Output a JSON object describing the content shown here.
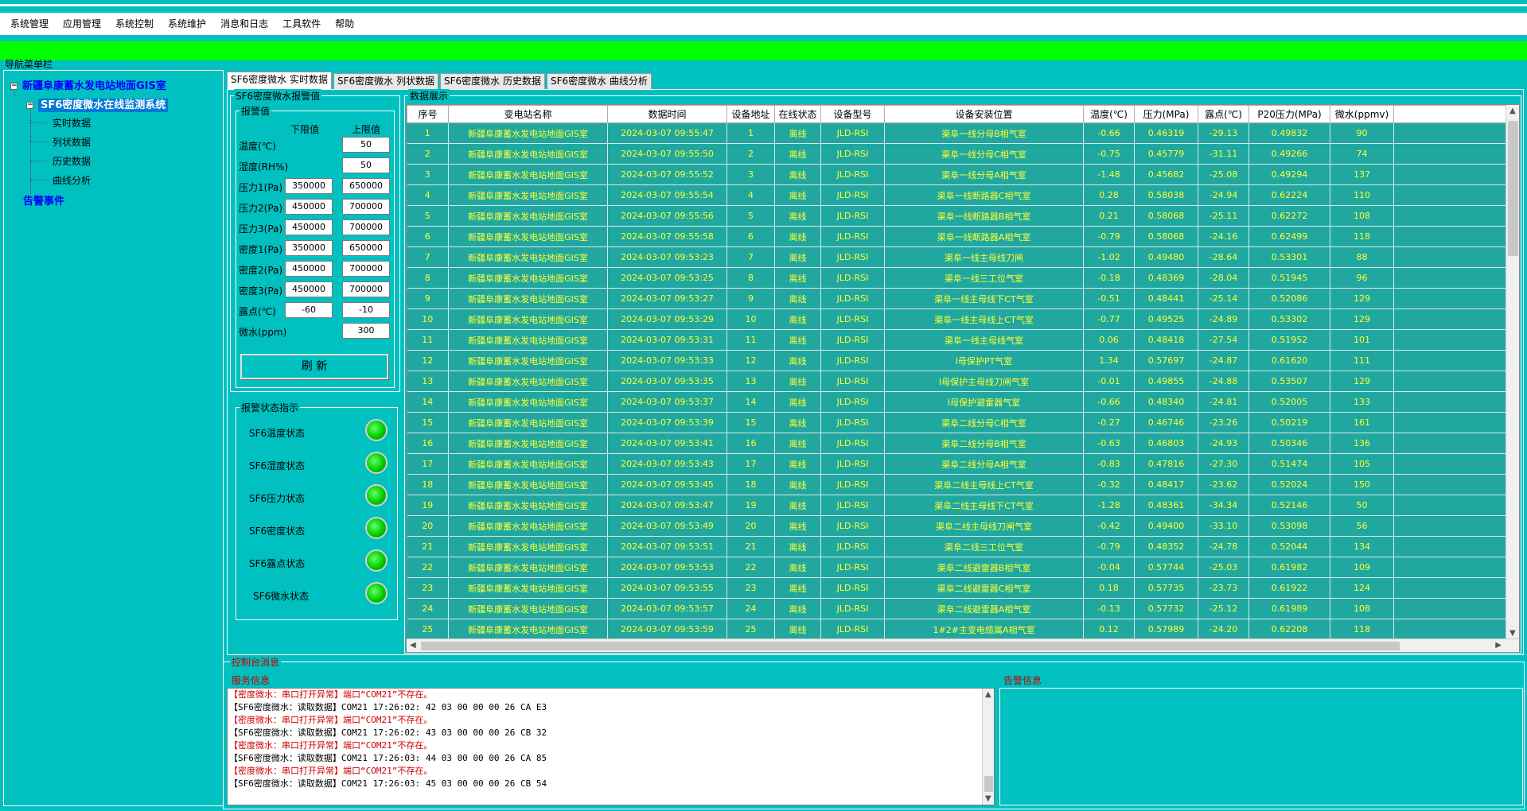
{
  "menu": [
    "系统管理",
    "应用管理",
    "系统控制",
    "系统维护",
    "消息和日志",
    "工具软件",
    "帮助"
  ],
  "nav": {
    "title": "导航菜单栏",
    "station": "新疆阜康蓄水发电站地面GIS室",
    "system": "SF6密度微水在线监测系统",
    "children": [
      "实时数据",
      "列状数据",
      "历史数据",
      "曲线分析"
    ],
    "alarm_events": "告警事件"
  },
  "tabs": [
    "SF6密度微水 实时数据",
    "SF6密度微水 列状数据",
    "SF6密度微水 历史数据",
    "SF6密度微水 曲线分析"
  ],
  "thresholds": {
    "group_title": "SF6密度微水报警值",
    "sub_title": "报警值",
    "lower_header": "下限值",
    "upper_header": "上限值",
    "rows": [
      {
        "label": "温度(℃)",
        "lower": "",
        "upper": "50"
      },
      {
        "label": "湿度(RH%)",
        "lower": "",
        "upper": "50"
      },
      {
        "label": "压力1(Pa)",
        "lower": "350000",
        "upper": "650000"
      },
      {
        "label": "压力2(Pa)",
        "lower": "450000",
        "upper": "700000"
      },
      {
        "label": "压力3(Pa)",
        "lower": "450000",
        "upper": "700000"
      },
      {
        "label": "密度1(Pa)",
        "lower": "350000",
        "upper": "650000"
      },
      {
        "label": "密度2(Pa)",
        "lower": "450000",
        "upper": "700000"
      },
      {
        "label": "密度3(Pa)",
        "lower": "450000",
        "upper": "700000"
      },
      {
        "label": "露点(℃)",
        "lower": "-60",
        "upper": "-10"
      },
      {
        "label": "微水(ppm)",
        "lower": "",
        "upper": "300"
      }
    ],
    "refresh_label": "刷 新"
  },
  "status": {
    "title": "报警状态指示",
    "items": [
      "SF6温度状态",
      "SF6湿度状态",
      "SF6压力状态",
      "SF6密度状态",
      "SF6露点状态",
      "SF6微水状态"
    ],
    "led_color": "#00cc00"
  },
  "grid": {
    "title": "数据展示",
    "columns": [
      "序号",
      "变电站名称",
      "数据时间",
      "设备地址",
      "在线状态",
      "设备型号",
      "设备安装位置",
      "温度(℃)",
      "压力(MPa)",
      "露点(℃)",
      "P20压力(MPa)",
      "微水(ppmv)",
      ""
    ],
    "rows": [
      [
        "1",
        "新疆阜康蓄水发电站地面GIS室",
        "2024-03-07 09:55:47",
        "1",
        "离线",
        "JLD-RSI",
        "渠阜一线分母B相气室",
        "-0.66",
        "0.46319",
        "-29.13",
        "0.49832",
        "90"
      ],
      [
        "2",
        "新疆阜康蓄水发电站地面GIS室",
        "2024-03-07 09:55:50",
        "2",
        "离线",
        "JLD-RSI",
        "渠阜一线分母C相气室",
        "-0.75",
        "0.45779",
        "-31.11",
        "0.49266",
        "74"
      ],
      [
        "3",
        "新疆阜康蓄水发电站地面GIS室",
        "2024-03-07 09:55:52",
        "3",
        "离线",
        "JLD-RSI",
        "渠阜一线分母A相气室",
        "-1.48",
        "0.45682",
        "-25.08",
        "0.49294",
        "137"
      ],
      [
        "4",
        "新疆阜康蓄水发电站地面GIS室",
        "2024-03-07 09:55:54",
        "4",
        "离线",
        "JLD-RSI",
        "渠阜一线断路器C相气室",
        "0.28",
        "0.58038",
        "-24.94",
        "0.62224",
        "110"
      ],
      [
        "5",
        "新疆阜康蓄水发电站地面GIS室",
        "2024-03-07 09:55:56",
        "5",
        "离线",
        "JLD-RSI",
        "渠阜一线断路器B相气室",
        "0.21",
        "0.58068",
        "-25.11",
        "0.62272",
        "108"
      ],
      [
        "6",
        "新疆阜康蓄水发电站地面GIS室",
        "2024-03-07 09:55:58",
        "6",
        "离线",
        "JLD-RSI",
        "渠阜一线断路器A相气室",
        "-0.79",
        "0.58068",
        "-24.16",
        "0.62499",
        "118"
      ],
      [
        "7",
        "新疆阜康蓄水发电站地面GIS室",
        "2024-03-07 09:53:23",
        "7",
        "离线",
        "JLD-RSI",
        "渠阜一线主母线刀闸",
        "-1.02",
        "0.49480",
        "-28.64",
        "0.53301",
        "88"
      ],
      [
        "8",
        "新疆阜康蓄水发电站地面GIS室",
        "2024-03-07 09:53:25",
        "8",
        "离线",
        "JLD-RSI",
        "渠阜一线三工位气室",
        "-0.18",
        "0.48369",
        "-28.04",
        "0.51945",
        "96"
      ],
      [
        "9",
        "新疆阜康蓄水发电站地面GIS室",
        "2024-03-07 09:53:27",
        "9",
        "离线",
        "JLD-RSI",
        "渠阜一线主母线下CT气室",
        "-0.51",
        "0.48441",
        "-25.14",
        "0.52086",
        "129"
      ],
      [
        "10",
        "新疆阜康蓄水发电站地面GIS室",
        "2024-03-07 09:53:29",
        "10",
        "离线",
        "JLD-RSI",
        "渠阜一线主母线上CT气室",
        "-0.77",
        "0.49525",
        "-24.89",
        "0.53302",
        "129"
      ],
      [
        "11",
        "新疆阜康蓄水发电站地面GIS室",
        "2024-03-07 09:53:31",
        "11",
        "离线",
        "JLD-RSI",
        "渠阜一线主母线气室",
        "0.06",
        "0.48418",
        "-27.54",
        "0.51952",
        "101"
      ],
      [
        "12",
        "新疆阜康蓄水发电站地面GIS室",
        "2024-03-07 09:53:33",
        "12",
        "离线",
        "JLD-RSI",
        "I母保护PT气室",
        "1.34",
        "0.57697",
        "-24.87",
        "0.61620",
        "111"
      ],
      [
        "13",
        "新疆阜康蓄水发电站地面GIS室",
        "2024-03-07 09:53:35",
        "13",
        "离线",
        "JLD-RSI",
        "I母保护主母线刀闸气室",
        "-0.01",
        "0.49855",
        "-24.88",
        "0.53507",
        "129"
      ],
      [
        "14",
        "新疆阜康蓄水发电站地面GIS室",
        "2024-03-07 09:53:37",
        "14",
        "离线",
        "JLD-RSI",
        "I母保护避雷器气室",
        "-0.66",
        "0.48340",
        "-24.81",
        "0.52005",
        "133"
      ],
      [
        "15",
        "新疆阜康蓄水发电站地面GIS室",
        "2024-03-07 09:53:39",
        "15",
        "离线",
        "JLD-RSI",
        "渠阜二线分母C相气室",
        "-0.27",
        "0.46746",
        "-23.26",
        "0.50219",
        "161"
      ],
      [
        "16",
        "新疆阜康蓄水发电站地面GIS室",
        "2024-03-07 09:53:41",
        "16",
        "离线",
        "JLD-RSI",
        "渠阜二线分母B相气室",
        "-0.63",
        "0.46803",
        "-24.93",
        "0.50346",
        "136"
      ],
      [
        "17",
        "新疆阜康蓄水发电站地面GIS室",
        "2024-03-07 09:53:43",
        "17",
        "离线",
        "JLD-RSI",
        "渠阜二线分母A相气室",
        "-0.83",
        "0.47816",
        "-27.30",
        "0.51474",
        "105"
      ],
      [
        "18",
        "新疆阜康蓄水发电站地面GIS室",
        "2024-03-07 09:53:45",
        "18",
        "离线",
        "JLD-RSI",
        "渠阜二线主母线上CT气室",
        "-0.32",
        "0.48417",
        "-23.62",
        "0.52024",
        "150"
      ],
      [
        "19",
        "新疆阜康蓄水发电站地面GIS室",
        "2024-03-07 09:53:47",
        "19",
        "离线",
        "JLD-RSI",
        "渠阜二线主母线下CT气室",
        "-1.28",
        "0.48361",
        "-34.34",
        "0.52146",
        "50"
      ],
      [
        "20",
        "新疆阜康蓄水发电站地面GIS室",
        "2024-03-07 09:53:49",
        "20",
        "离线",
        "JLD-RSI",
        "渠阜二线主母线刀闸气室",
        "-0.42",
        "0.49400",
        "-33.10",
        "0.53098",
        "56"
      ],
      [
        "21",
        "新疆阜康蓄水发电站地面GIS室",
        "2024-03-07 09:53:51",
        "21",
        "离线",
        "JLD-RSI",
        "渠阜二线三工位气室",
        "-0.79",
        "0.48352",
        "-24.78",
        "0.52044",
        "134"
      ],
      [
        "22",
        "新疆阜康蓄水发电站地面GIS室",
        "2024-03-07 09:53:53",
        "22",
        "离线",
        "JLD-RSI",
        "渠阜二线避雷器B相气室",
        "-0.04",
        "0.57744",
        "-25.03",
        "0.61982",
        "109"
      ],
      [
        "23",
        "新疆阜康蓄水发电站地面GIS室",
        "2024-03-07 09:53:55",
        "23",
        "离线",
        "JLD-RSI",
        "渠阜二线避雷器C相气室",
        "0.18",
        "0.57735",
        "-23.73",
        "0.61922",
        "124"
      ],
      [
        "24",
        "新疆阜康蓄水发电站地面GIS室",
        "2024-03-07 09:53:57",
        "24",
        "离线",
        "JLD-RSI",
        "渠阜二线避雷器A相气室",
        "-0.13",
        "0.57732",
        "-25.12",
        "0.61989",
        "108"
      ],
      [
        "25",
        "新疆阜康蓄水发电站地面GIS室",
        "2024-03-07 09:53:59",
        "25",
        "离线",
        "JLD-RSI",
        "1#2#主变电缆属A相气室",
        "0.12",
        "0.57989",
        "-24.20",
        "0.62208",
        "118"
      ]
    ]
  },
  "console": {
    "title": "控制台消息",
    "service_title": "服务信息",
    "alarm_title": "告警信息",
    "lines": [
      {
        "text": "【密度微水：串口打开异常】端口“COM21”不存在。",
        "type": "error"
      },
      {
        "text": "【SF6密度微水：读取数据】COM21  17:26:02: 42 03 00 00 00 26 CA E3",
        "type": "info"
      },
      {
        "text": "【密度微水：串口打开异常】端口“COM21”不存在。",
        "type": "error"
      },
      {
        "text": "【SF6密度微水：读取数据】COM21  17:26:02: 43 03 00 00 00 26 CB 32",
        "type": "info"
      },
      {
        "text": "【密度微水：串口打开异常】端口“COM21”不存在。",
        "type": "error"
      },
      {
        "text": "【SF6密度微水：读取数据】COM21  17:26:03: 44 03 00 00 00 26 CA 85",
        "type": "info"
      },
      {
        "text": "【密度微水：串口打开异常】端口“COM21”不存在。",
        "type": "error"
      },
      {
        "text": "【SF6密度微水：读取数据】COM21  17:26:03: 45 03 00 00 00 26 CB 54",
        "type": "info"
      }
    ]
  },
  "colors": {
    "background": "#00c0c0",
    "banner": "#00ff00",
    "grid_bg": "#20a8a0",
    "grid_text": "#ffff33",
    "error_text": "#d00000"
  }
}
